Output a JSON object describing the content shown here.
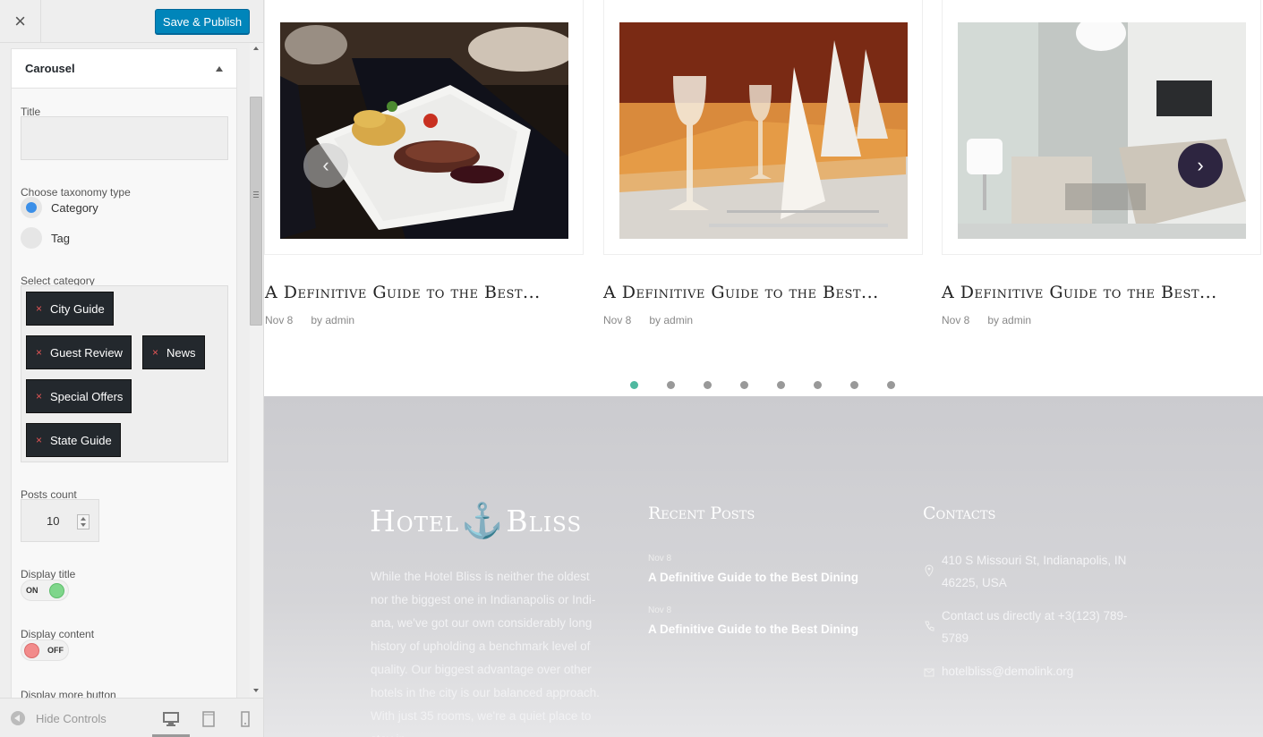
{
  "header": {
    "close_glyph": "×",
    "publish_label": "Save & Publish"
  },
  "section": {
    "title": "Carousel"
  },
  "fields": {
    "title_label": "Title",
    "title_value": "",
    "taxonomy_label": "Choose taxonomy type",
    "taxonomy_options": [
      {
        "label": "Category",
        "selected": true
      },
      {
        "label": "Tag",
        "selected": false
      }
    ],
    "category_label": "Select category",
    "categories": [
      "City Guide",
      "Guest Review",
      "News",
      "Special Offers",
      "State Guide"
    ],
    "remove_glyph": "×",
    "posts_count_label": "Posts count",
    "posts_count_value": "10",
    "display_title_label": "Display title",
    "display_title_state": "ON",
    "display_content_label": "Display content",
    "display_content_state": "OFF",
    "display_more_label": "Display more button"
  },
  "footer_controls": {
    "hide_label": "Hide Controls",
    "devices": [
      "desktop-icon",
      "tablet-icon",
      "mobile-icon"
    ]
  },
  "carousel": {
    "posts": [
      {
        "title": "A Definitive Guide to the Best...",
        "date": "Nov 8",
        "author": "by admin"
      },
      {
        "title": "A Definitive Guide to the Best...",
        "date": "Nov 8",
        "author": "by admin"
      },
      {
        "title": "A Definitive Guide to the Best...",
        "date": "Nov 8",
        "author": "by admin"
      }
    ],
    "prev_glyph": "‹",
    "next_glyph": "›",
    "dot_count": 8,
    "active_dot": 0,
    "accent_color": "#4fb9a0"
  },
  "site_footer": {
    "brand_left": "Hotel",
    "brand_right": "Bliss",
    "about": "While the Hotel Bliss is neither the oldest nor the biggest one in Indianapolis or Indi-ana, we've got our own considerably long history of upholding a benchmark level of quality. Our biggest advantage over other hotels in the city is our balanced approach. With just 35 rooms, we're a quiet place to stay in.",
    "recent_heading": "Recent Posts",
    "recent_posts": [
      {
        "date": "Nov 8",
        "title": "A Definitive Guide to the Best Dining"
      },
      {
        "date": "Nov 8",
        "title": "A Definitive Guide to the Best Dining"
      }
    ],
    "contacts_heading": "Contacts",
    "address": "410 S Missouri St, Indianapolis, IN 46225, USA",
    "phone": "Contact us directly at +3(123) 789-5789",
    "email": "hotelbliss@demolink.org"
  }
}
